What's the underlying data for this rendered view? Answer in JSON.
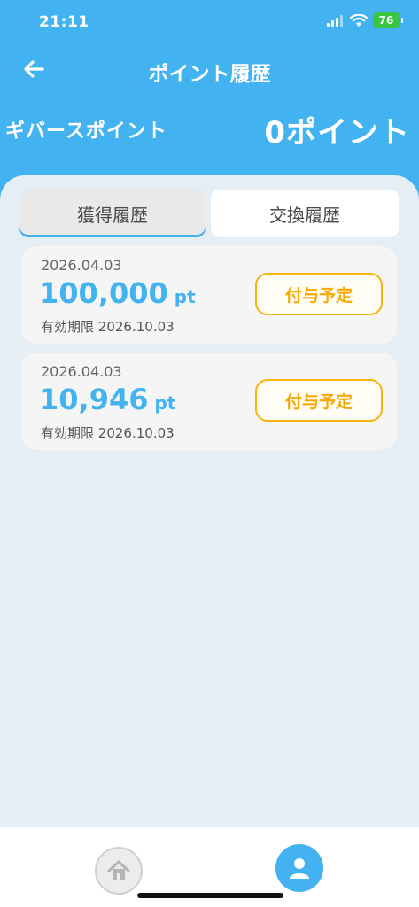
{
  "status_bar": {
    "time": "21:11",
    "battery": "76"
  },
  "nav": {
    "title": "ポイント履歴",
    "back_icon": "arrow-left-icon"
  },
  "points": {
    "label": "ギバースポイント",
    "value": "0ポイント"
  },
  "tabs": [
    {
      "label": "獲得履歴",
      "selected": true
    },
    {
      "label": "交換履歴",
      "selected": false
    }
  ],
  "history": [
    {
      "date": "2026.04.03",
      "amount": "100,000",
      "unit": "pt",
      "expiry_label": "有効期限",
      "expiry_date": "2026.10.03",
      "status": "付与予定"
    },
    {
      "date": "2026.04.03",
      "amount": "10,946",
      "unit": "pt",
      "expiry_label": "有効期限",
      "expiry_date": "2026.10.03",
      "status": "付与予定"
    }
  ],
  "bottom_nav": {
    "items": [
      {
        "icon": "home-icon",
        "active": false
      },
      {
        "icon": "user-icon",
        "active": true
      }
    ]
  },
  "colors": {
    "accent": "#42b2f0",
    "status_orange": "#f5a900",
    "background": "#e6eef5"
  }
}
